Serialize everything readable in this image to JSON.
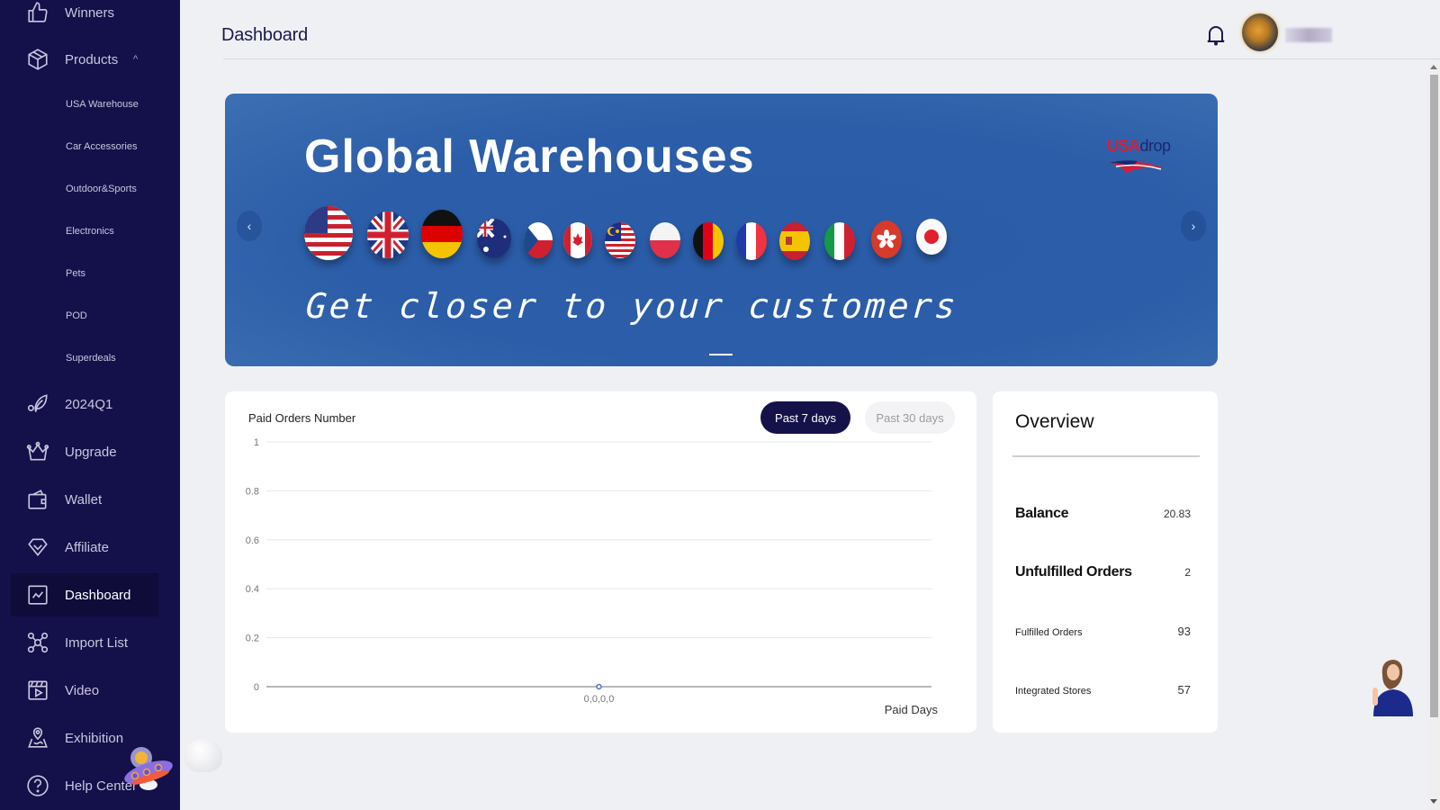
{
  "sidebar": {
    "items": [
      {
        "label": "Winners",
        "icon": "thumbs-up-icon"
      },
      {
        "label": "Products",
        "icon": "box-icon",
        "expanded": true
      },
      {
        "label": "2024Q1",
        "icon": "leaf-icon"
      },
      {
        "label": "Upgrade",
        "icon": "crown-icon"
      },
      {
        "label": "Wallet",
        "icon": "wallet-icon"
      },
      {
        "label": "Affiliate",
        "icon": "diamond-icon"
      },
      {
        "label": "Dashboard",
        "icon": "chart-line-icon",
        "active": true
      },
      {
        "label": "Import List",
        "icon": "network-icon"
      },
      {
        "label": "Video",
        "icon": "video-icon"
      },
      {
        "label": "Exhibition",
        "icon": "map-pin-icon"
      },
      {
        "label": "Help Center",
        "icon": "question-icon"
      }
    ],
    "sub_items": [
      "USA Warehouse",
      "Car Accessories",
      "Outdoor&Sports",
      "Electronics",
      "Pets",
      "POD",
      "Superdeals"
    ],
    "expand_chevron": "^"
  },
  "header": {
    "title": "Dashboard",
    "notification_icon": "bell-icon"
  },
  "banner": {
    "title": "Global Warehouses",
    "subtitle": "Get closer to your customers",
    "logo_text_a": "USA",
    "logo_text_b": "drop",
    "prev": "‹",
    "next": "›",
    "flags": [
      "USA",
      "UK",
      "Germany",
      "Australia",
      "Czech Republic",
      "Canada",
      "Malaysia",
      "Poland",
      "Belgium",
      "France",
      "Spain",
      "Italy",
      "Hong Kong",
      "Japan"
    ]
  },
  "chart_panel": {
    "title": "Paid Orders Number",
    "range_buttons": [
      {
        "label": "Past 7 days",
        "active": true
      },
      {
        "label": "Past 30 days",
        "active": false
      }
    ]
  },
  "chart_data": {
    "type": "line",
    "title": "Paid Orders Number",
    "xlabel": "Paid Days",
    "ylabel": "",
    "categories": [
      "0,0,0,0"
    ],
    "series": [
      {
        "name": "Paid Orders",
        "values": [
          0
        ]
      }
    ],
    "y_ticks": [
      "0",
      "0.2",
      "0.4",
      "0.6",
      "0.8",
      "1"
    ],
    "y_tick_values": [
      0,
      0.2,
      0.4,
      0.6,
      0.8,
      1
    ],
    "ylim": [
      0,
      1
    ],
    "grid": true,
    "series_color": "#5470c6"
  },
  "overview": {
    "title": "Overview",
    "rows": [
      {
        "label": "Balance",
        "value": "20.83"
      },
      {
        "label": "Unfulfilled Orders",
        "value": "2"
      },
      {
        "label": "Fulfilled Orders",
        "value": "93"
      },
      {
        "label": "Integrated Stores",
        "value": "57"
      }
    ]
  },
  "colors": {
    "sidebar_bg": "#14104a",
    "accent": "#15124a",
    "banner_bg": "#2b5da8"
  }
}
